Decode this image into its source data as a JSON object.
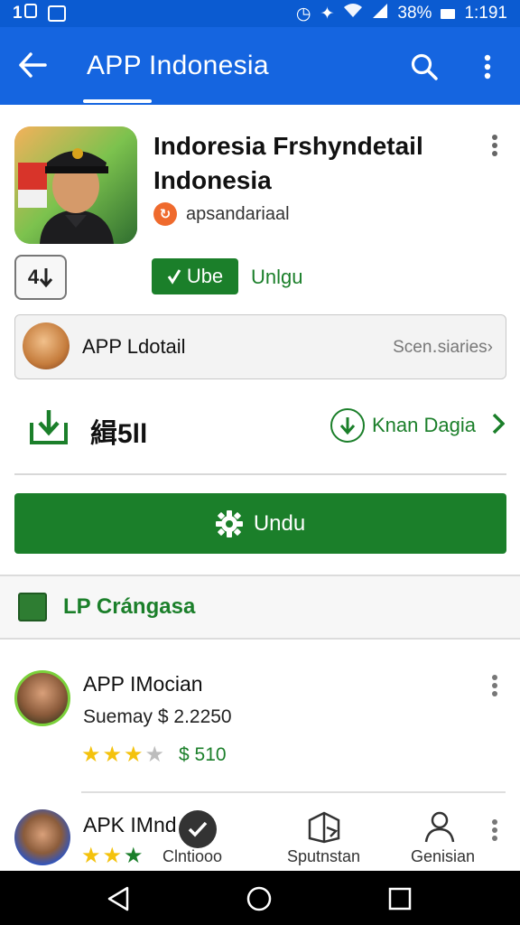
{
  "status_bar": {
    "left_text": "1",
    "battery": "38%",
    "time": "1:191"
  },
  "app_bar": {
    "title": "APP Indonesia",
    "icons": [
      "back-arrow-icon",
      "search-icon",
      "more-vert-icon"
    ]
  },
  "app_header": {
    "title": "Indoresia Frshyndetail Indonesia",
    "developer": "apsandariaal",
    "age_rating": "4",
    "primary_button": "Ube",
    "secondary_link": "Unlgu"
  },
  "detail_row": {
    "label": "APP Ldotail",
    "link": "Scen․siaries›"
  },
  "download_row": {
    "count": "緝5ll",
    "link_label": "Knan Dagia"
  },
  "install_button": {
    "label": "Undu"
  },
  "section": {
    "title": "LP Crángasa"
  },
  "list_items": [
    {
      "title": "APP IMocian",
      "subtitle": "Suemay $ 2.2250",
      "price": "$ 510",
      "rating_icons": "3.5 of 5 stars"
    },
    {
      "title": "APK IMnd",
      "rating_icons": "3 of 5 stars"
    }
  ],
  "bottom_nav": {
    "items": [
      {
        "label": "Clntiooo",
        "icon": "check-circle-icon"
      },
      {
        "label": "Sputnstan",
        "icon": "map-box-icon"
      },
      {
        "label": "Genisian",
        "icon": "person-icon"
      }
    ]
  },
  "colors": {
    "app_bar": "#1565e0",
    "status_bar": "#0b5bd1",
    "accent_green": "#1b7f2a",
    "star": "#f4c20d"
  }
}
